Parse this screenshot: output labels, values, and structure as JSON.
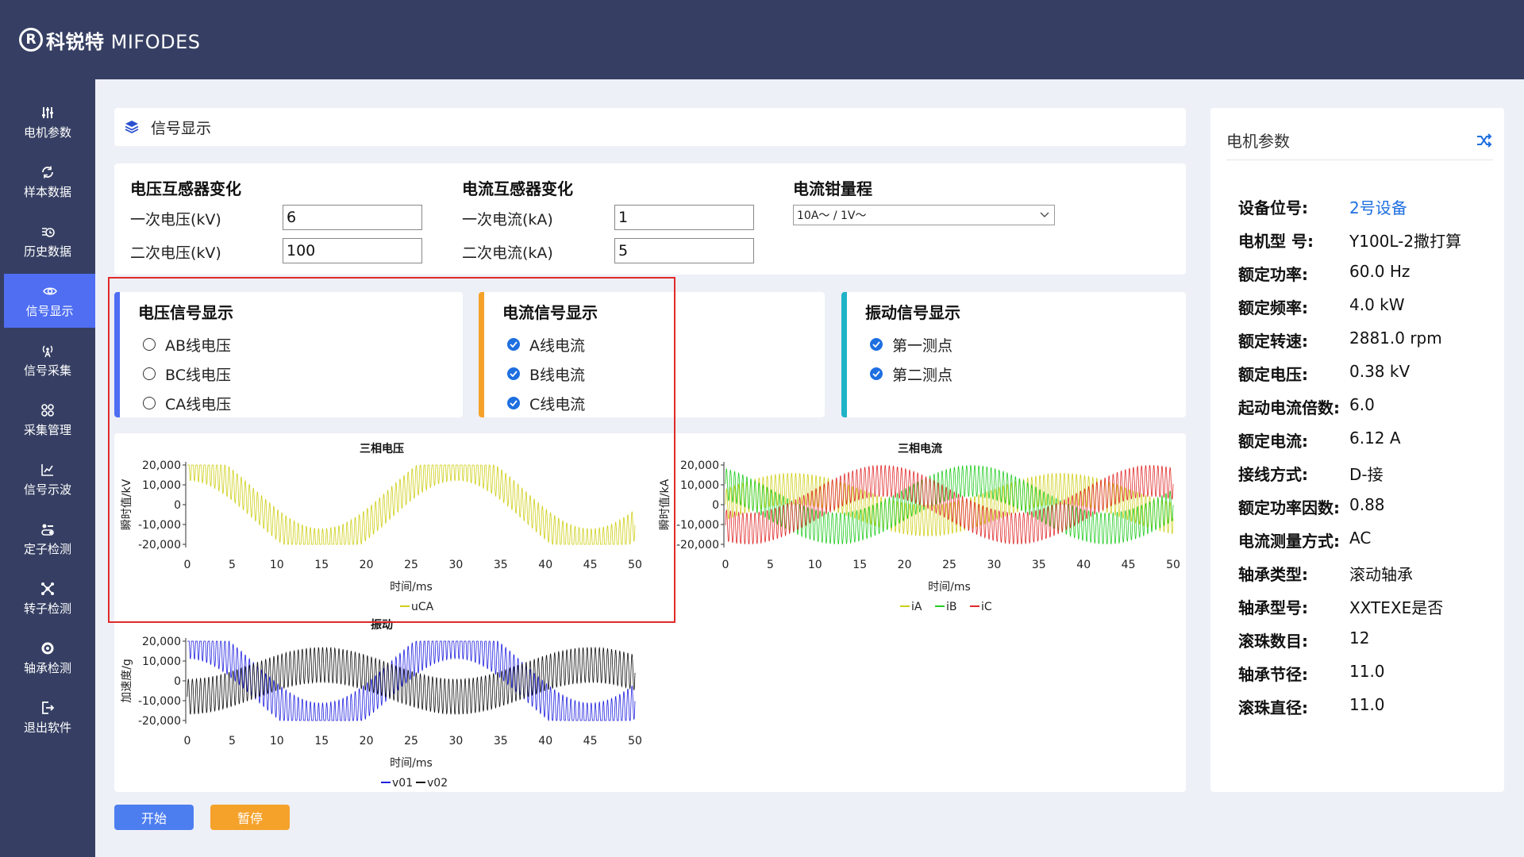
{
  "header": {
    "logo_mark": "R",
    "brand_cn": "科锐特",
    "brand_en": "MIFODES"
  },
  "sidebar": {
    "items": [
      {
        "label": "电机参数",
        "icon": "sliders-icon",
        "active": false
      },
      {
        "label": "样本数据",
        "icon": "refresh-icon",
        "active": false
      },
      {
        "label": "历史数据",
        "icon": "history-icon",
        "active": false
      },
      {
        "label": "信号显示",
        "icon": "eye-icon",
        "active": true
      },
      {
        "label": "信号采集",
        "icon": "antenna-icon",
        "active": false
      },
      {
        "label": "采集管理",
        "icon": "grid-icon",
        "active": false
      },
      {
        "label": "信号示波",
        "icon": "line-chart-icon",
        "active": false
      },
      {
        "label": "定子检测",
        "icon": "toggle-icon",
        "active": false
      },
      {
        "label": "转子检测",
        "icon": "nodes-icon",
        "active": false
      },
      {
        "label": "轴承检测",
        "icon": "gear-icon",
        "active": false
      },
      {
        "label": "退出软件",
        "icon": "logout-icon",
        "active": false
      }
    ]
  },
  "title": {
    "label": "信号显示",
    "icon": "layers-icon"
  },
  "form": {
    "voltage": {
      "title": "电压互感器变化",
      "primary_label": "一次电压(kV)",
      "primary_value": "6",
      "secondary_label": "二次电压(kV)",
      "secondary_value": "100"
    },
    "current": {
      "title": "电流互感器变化",
      "primary_label": "一次电流(kA)",
      "primary_value": "1",
      "secondary_label": "二次电流(kA)",
      "secondary_value": "5"
    },
    "clamp": {
      "title": "电流钳量程",
      "selected": "10A～ / 1V～"
    }
  },
  "signals": {
    "voltage": {
      "title": "电压信号显示",
      "accent": "#4f6ef2",
      "options": [
        {
          "label": "AB线电压",
          "checked": false
        },
        {
          "label": "BC线电压",
          "checked": false
        },
        {
          "label": "CA线电压",
          "checked": false
        }
      ]
    },
    "current": {
      "title": "电流信号显示",
      "accent": "#f5a22b",
      "options": [
        {
          "label": "A线电流",
          "checked": true
        },
        {
          "label": "B线电流",
          "checked": true
        },
        {
          "label": "C线电流",
          "checked": true
        }
      ]
    },
    "vibration": {
      "title": "振动信号显示",
      "accent": "#1fb3c6",
      "options": [
        {
          "label": "第一测点",
          "checked": true
        },
        {
          "label": "第二测点",
          "checked": true
        }
      ]
    }
  },
  "chart_data": [
    {
      "type": "line",
      "title": "三相电压",
      "xlabel": "时间/ms",
      "ylabel": "瞬时值/kV",
      "xlim": [
        0,
        50
      ],
      "ylim": [
        -20000,
        20000
      ],
      "xticks": [
        "0",
        "5",
        "10",
        "15",
        "20",
        "25",
        "30",
        "35",
        "40",
        "45",
        "50"
      ],
      "yticks": [
        "20,000",
        "10,000",
        "0",
        "-10,000",
        "-20,000"
      ],
      "series": [
        {
          "name": "uCA",
          "color": "#cfcf1a",
          "amplitude": 20000,
          "ripple": 8000,
          "frequency_hz": 33.3,
          "phase_deg": 90
        }
      ]
    },
    {
      "type": "line",
      "title": "三相电流",
      "xlabel": "时间/ms",
      "ylabel": "瞬时值/kA",
      "xlim": [
        0,
        50
      ],
      "ylim": [
        -20000,
        20000
      ],
      "xticks": [
        "0",
        "5",
        "10",
        "15",
        "20",
        "25",
        "30",
        "35",
        "40",
        "45",
        "50"
      ],
      "yticks": [
        "20,000",
        "10,000",
        "0",
        "-10,000",
        "-20,000"
      ],
      "series": [
        {
          "name": "iA",
          "color": "#cfcf1a",
          "amplitude": 8000,
          "ripple": 8000,
          "frequency_hz": 33.3,
          "phase_deg": 0
        },
        {
          "name": "iB",
          "color": "#22cc22",
          "amplitude": 12000,
          "ripple": 8000,
          "frequency_hz": 33.3,
          "phase_deg": 120
        },
        {
          "name": "iC",
          "color": "#e02a2a",
          "amplitude": 12000,
          "ripple": 8000,
          "frequency_hz": 33.3,
          "phase_deg": 240
        }
      ]
    },
    {
      "type": "line",
      "title": "振动",
      "xlabel": "时间/ms",
      "ylabel": "加速度/g",
      "xlim": [
        0,
        50
      ],
      "ylim": [
        -20000,
        20000
      ],
      "xticks": [
        "0",
        "5",
        "10",
        "15",
        "20",
        "25",
        "30",
        "35",
        "40",
        "45",
        "50"
      ],
      "yticks": [
        "20,000",
        "10,000",
        "0",
        "-10,000",
        "-20,000"
      ],
      "series": [
        {
          "name": "v01",
          "color": "#2020e0",
          "amplitude": 20000,
          "ripple": 9000,
          "frequency_hz": 33.3,
          "phase_deg": 90
        },
        {
          "name": "v02",
          "color": "#111111",
          "amplitude": 8000,
          "ripple": 9000,
          "frequency_hz": 33.3,
          "phase_deg": 270
        }
      ]
    }
  ],
  "buttons": {
    "start": "开始",
    "pause": "暂停"
  },
  "params": {
    "title": "电机参数",
    "rows": [
      {
        "k": "设备位号:",
        "v": "2号设备",
        "link": true
      },
      {
        "k": "电机型 号:",
        "v": "Y100L-2撒打算"
      },
      {
        "k": "额定功率:",
        "v": "60.0 Hz"
      },
      {
        "k": "额定频率:",
        "v": "4.0 kW"
      },
      {
        "k": "额定转速:",
        "v": "2881.0 rpm"
      },
      {
        "k": "额定电压:",
        "v": "0.38 kV"
      },
      {
        "k": "起动电流倍数:",
        "v": "6.0"
      },
      {
        "k": "额定电流:",
        "v": "6.12 A"
      },
      {
        "k": "接线方式:",
        "v": "D-接"
      },
      {
        "k": "额定功率因数:",
        "v": "0.88"
      },
      {
        "k": "电流测量方式:",
        "v": "AC"
      },
      {
        "k": "轴承类型:",
        "v": "滚动轴承"
      },
      {
        "k": "轴承型号:",
        "v": "XXTEXE是否"
      },
      {
        "k": "滚珠数目:",
        "v": "12"
      },
      {
        "k": "轴承节径:",
        "v": "11.0"
      },
      {
        "k": "滚珠直径:",
        "v": "11.0"
      }
    ]
  }
}
